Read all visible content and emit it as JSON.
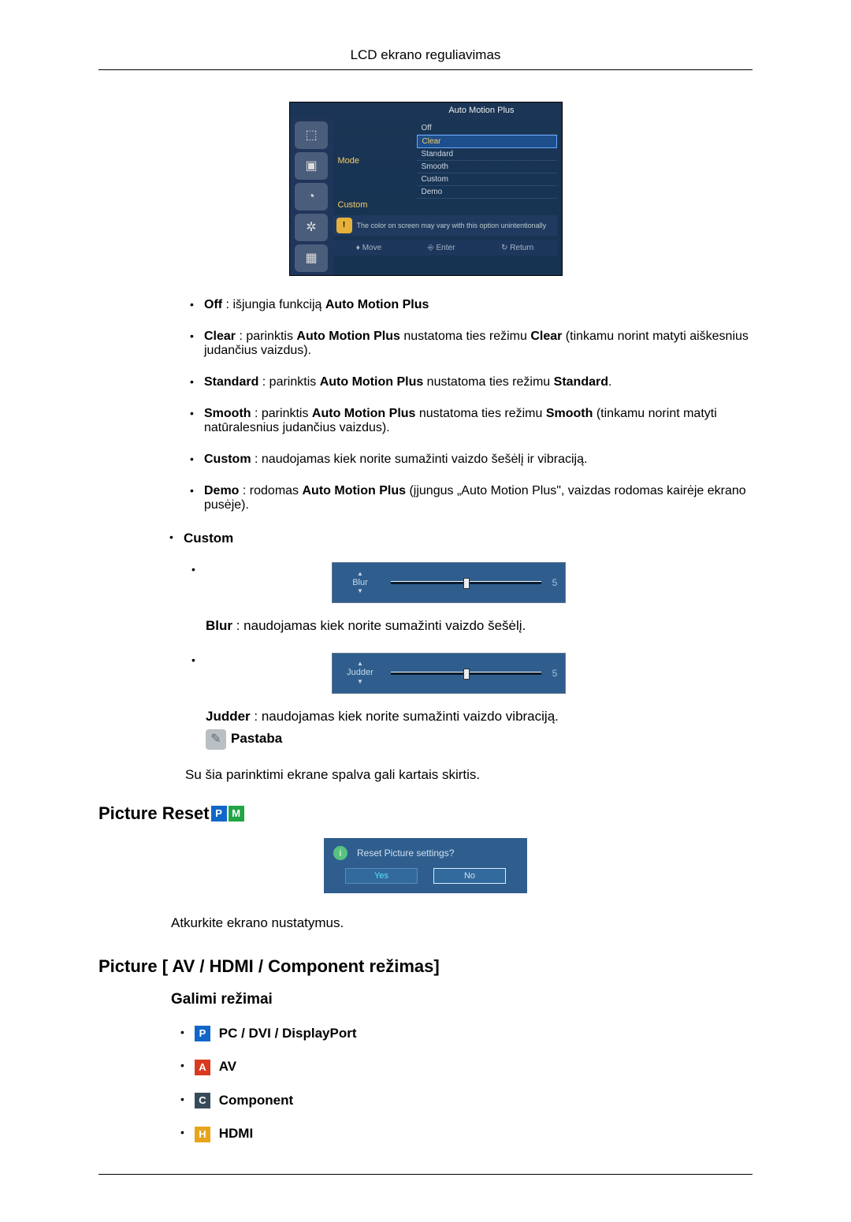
{
  "header": {
    "title": "LCD ekrano reguliavimas"
  },
  "osd": {
    "title": "Auto Motion Plus",
    "labels": {
      "mode": "Mode",
      "custom": "Custom"
    },
    "options": [
      "Off",
      "Clear",
      "Standard",
      "Smooth",
      "Custom",
      "Demo"
    ],
    "highlight_index": 1,
    "warn": "The color on screen may vary with this option unintentionally",
    "footer": {
      "move": "Move",
      "enter": "Enter",
      "ret": "Return"
    }
  },
  "bullets": {
    "off_b": "Off",
    "off_t": " : išjungia funkciją ",
    "off_b2": "Auto Motion Plus",
    "clear_b": "Clear",
    "clear_t1": " : parinktis ",
    "clear_b2": "Auto Motion Plus",
    "clear_t2": " nustatoma ties režimu ",
    "clear_b3": "Clear",
    "clear_t3": " (tinkamu norint matyti aiškesnius judančius vaizdus).",
    "std_b": "Standard",
    "std_t1": " : parinktis ",
    "std_b2": "Auto Motion Plus",
    "std_t2": " nustatoma ties režimu ",
    "std_b3": "Standard",
    "std_t3": ".",
    "smooth_b": "Smooth",
    "smooth_t1": " : parinktis ",
    "smooth_b2": "Auto Motion Plus",
    "smooth_t2": " nustatoma ties režimu ",
    "smooth_b3": "Smooth",
    "smooth_t3": " (tinkamu norint matyti natūralesnius judančius vaizdus).",
    "custom_b": "Custom",
    "custom_t": " : naudojamas kiek norite sumažinti vaizdo šešėlį ir vibraciją.",
    "demo_b": "Demo",
    "demo_t1": " : rodomas ",
    "demo_b2": "Auto Motion Plus",
    "demo_t2": " (įjungus „Auto Motion Plus\", vaizdas rodomas kairėje ekrano pusėje)."
  },
  "custom_section": {
    "title": "Custom",
    "blur_label": "Blur",
    "blur_val": "5",
    "blur_desc_b": "Blur",
    "blur_desc": " : naudojamas kiek norite sumažinti vaizdo šešėlį.",
    "judder_label": "Judder",
    "judder_val": "5",
    "judder_desc_b": "Judder",
    "judder_desc": " : naudojamas kiek norite sumažinti vaizdo vibraciją.",
    "note_label": "Pastaba",
    "note_text": "Su šia parinktimi ekrane spalva gali kartais skirtis."
  },
  "picture_reset": {
    "title": "Picture Reset",
    "question": "Reset Picture settings?",
    "yes": "Yes",
    "no": "No",
    "restore": "Atkurkite ekrano nustatymus."
  },
  "picture_mode": {
    "title": "Picture [ AV / HDMI / Component režimas]",
    "subtitle": "Galimi režimai",
    "modes": {
      "pc": "PC / DVI / DisplayPort",
      "av": "AV",
      "comp": "Component",
      "hdmi": "HDMI"
    }
  }
}
